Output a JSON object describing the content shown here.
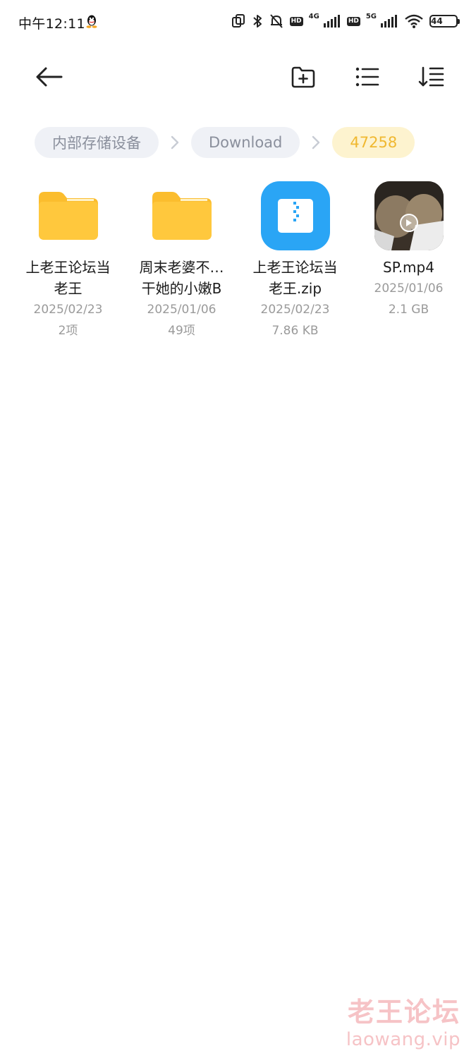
{
  "status_bar": {
    "time": "中午12:11",
    "battery": "44",
    "network_1": "4G",
    "network_2": "5G",
    "hd": "HD"
  },
  "toolbar": {
    "back_icon": "arrow-left-icon",
    "new_folder_icon": "folder-add-icon",
    "view_icon": "list-view-icon",
    "sort_icon": "sort-icon"
  },
  "breadcrumb": {
    "items": [
      "内部存储设备",
      "Download",
      "47258"
    ],
    "active_color": "#f0b830"
  },
  "files": [
    {
      "name_line1": "上老王论坛当",
      "name_line2": "老王",
      "date": "2025/02/23",
      "detail": "2项",
      "type": "folder"
    },
    {
      "name_line1": "周末老婆不…",
      "name_line2": "干她的小嫩B",
      "date": "2025/01/06",
      "detail": "49项",
      "type": "folder"
    },
    {
      "name_line1": "上老王论坛当",
      "name_line2": "老王.zip",
      "date": "2025/02/23",
      "detail": "7.86 KB",
      "type": "zip"
    },
    {
      "name_line1": "SP.mp4",
      "name_line2": "",
      "date": "2025/01/06",
      "detail": "2.1 GB",
      "type": "video"
    }
  ],
  "watermark": {
    "title": "老王论坛",
    "url": "laowang.vip"
  },
  "colors": {
    "folder": "#fbbd2e",
    "zip": "#2aa5f5",
    "crumb_bg": "#eff1f6",
    "crumb_active_bg": "#fdf3cf"
  }
}
